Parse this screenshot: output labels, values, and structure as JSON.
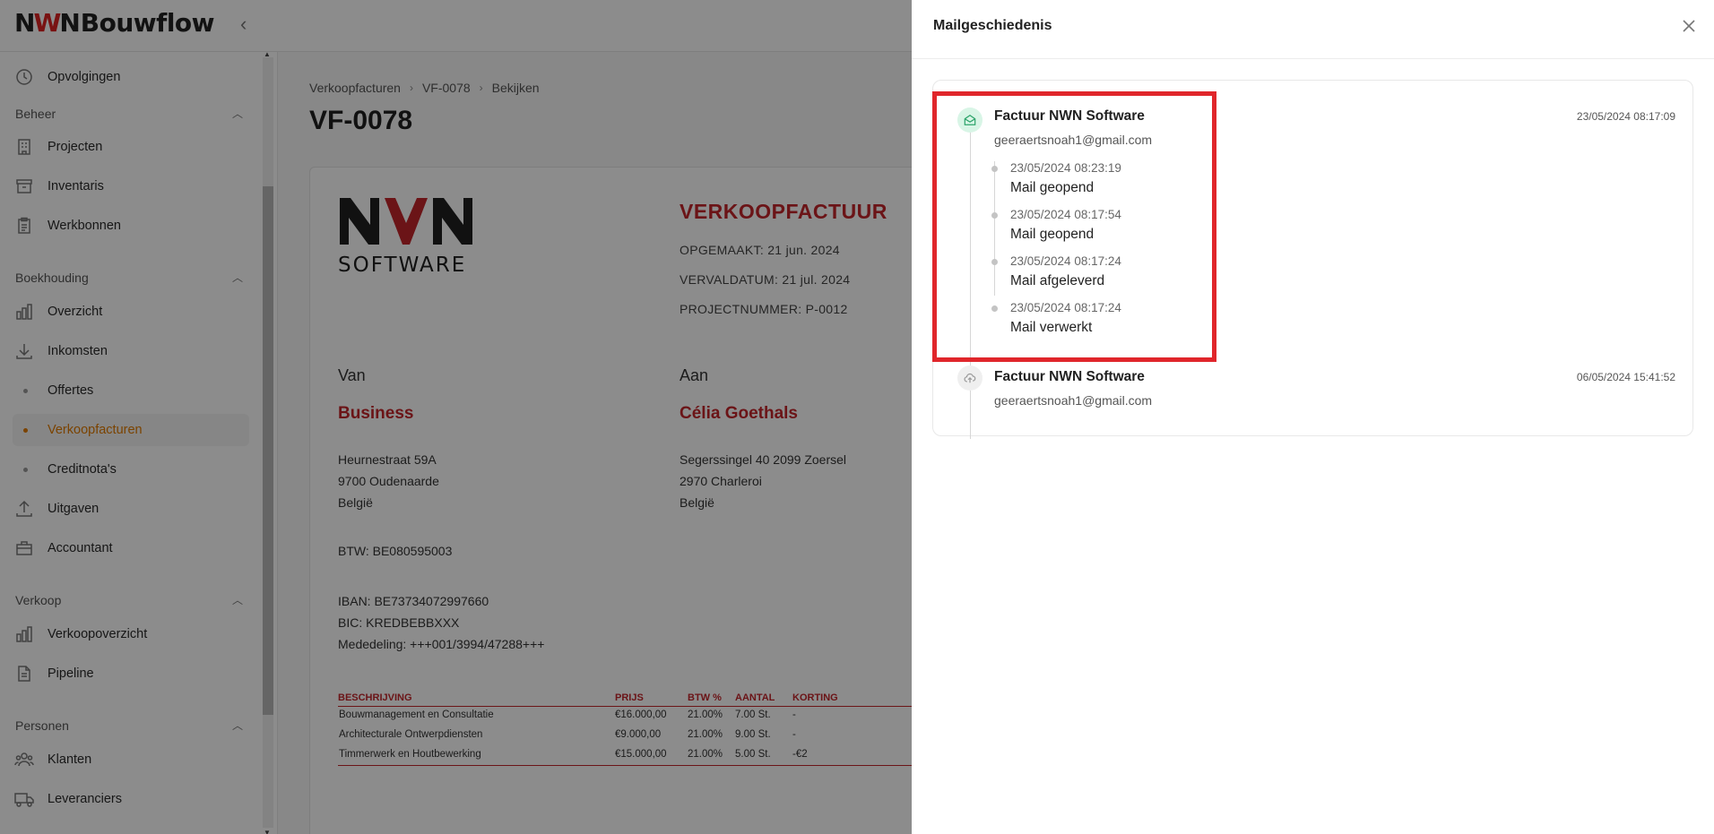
{
  "app": {
    "logo_mark_left": "N",
    "logo_mark_mid": "W",
    "logo_mark_right": "N",
    "logo_text": "Bouwflow",
    "collapse_symbol": "‹"
  },
  "sidebar": {
    "top_item": "Opvolgingen",
    "sections": {
      "beheer": "Beheer",
      "boekhouding": "Boekhouding",
      "verkoop": "Verkoop",
      "personen": "Personen"
    },
    "items": {
      "projecten": "Projecten",
      "inventaris": "Inventaris",
      "werkbonnen": "Werkbonnen",
      "overzicht": "Overzicht",
      "inkomsten": "Inkomsten",
      "offertes": "Offertes",
      "verkoopfacturen": "Verkoopfacturen",
      "creditnotas": "Creditnota's",
      "uitgaven": "Uitgaven",
      "accountant": "Accountant",
      "verkoopoverzicht": "Verkoopoverzicht",
      "pipeline": "Pipeline",
      "klanten": "Klanten",
      "leveranciers": "Leveranciers"
    },
    "chevron": "︿"
  },
  "main": {
    "breadcrumb": [
      "Verkoopfacturen",
      "VF-0078",
      "Bekijken"
    ],
    "breadcrumb_sep": "›",
    "title": "VF-0078",
    "document": {
      "logo_word": "SOFTWARE",
      "heading": "VERKOOPFACTUUR",
      "opgemaakt": "OPGEMAAKT: 21 jun. 2024",
      "vervaldatum": "VERVALDATUM: 21 jul. 2024",
      "projectnummer": "PROJECTNUMMER: P-0012",
      "van_label": "Van",
      "aan_label": "Aan",
      "van_name": "Business",
      "aan_name": "Célia Goethals",
      "van_address": [
        "Heurnestraat 59A",
        "9700 Oudenaarde",
        "België"
      ],
      "aan_address": [
        "Segerssingel 40 2099 Zoersel",
        "2970 Charleroi",
        "België"
      ],
      "btw": "BTW: BE080595003",
      "iban": "IBAN: BE73734072997660",
      "bic": "BIC: KREDBEBBXXX",
      "mededeling": "Mededeling: +++001/3994/47288+++",
      "table_headers": [
        "BESCHRIJVING",
        "PRIJS",
        "BTW %",
        "AANTAL",
        "KORTING"
      ],
      "table_rows": [
        [
          "Bouwmanagement en Consultatie",
          "€16.000,00",
          "21.00%",
          "7.00 St.",
          "-"
        ],
        [
          "Architecturale Ontwerpdiensten",
          "€9.000,00",
          "21.00%",
          "9.00 St.",
          "-"
        ],
        [
          "Timmerwerk en Houtbewerking",
          "€15.000,00",
          "21.00%",
          "5.00 St.",
          "-€2"
        ]
      ]
    }
  },
  "drawer": {
    "title": "Mailgeschiedenis",
    "entries": [
      {
        "title": "Factuur NWN Software",
        "email": "geeraertsnoah1@gmail.com",
        "date": "23/05/2024 08:17:09",
        "icon": "envelope-open-icon",
        "events": [
          {
            "time": "23/05/2024 08:23:19",
            "status": "Mail geopend"
          },
          {
            "time": "23/05/2024 08:17:54",
            "status": "Mail geopend"
          },
          {
            "time": "23/05/2024 08:17:24",
            "status": "Mail afgeleverd"
          },
          {
            "time": "23/05/2024 08:17:24",
            "status": "Mail verwerkt"
          }
        ]
      },
      {
        "title": "Factuur NWN Software",
        "email": "geeraertsnoah1@gmail.com",
        "date": "06/05/2024 15:41:52",
        "icon": "cloud-upload-icon",
        "events": []
      }
    ]
  },
  "colors": {
    "accent_orange": "#e07b00",
    "brand_red": "#c3262b",
    "highlight_red": "#e0262b",
    "success_green": "#2fa56c"
  }
}
